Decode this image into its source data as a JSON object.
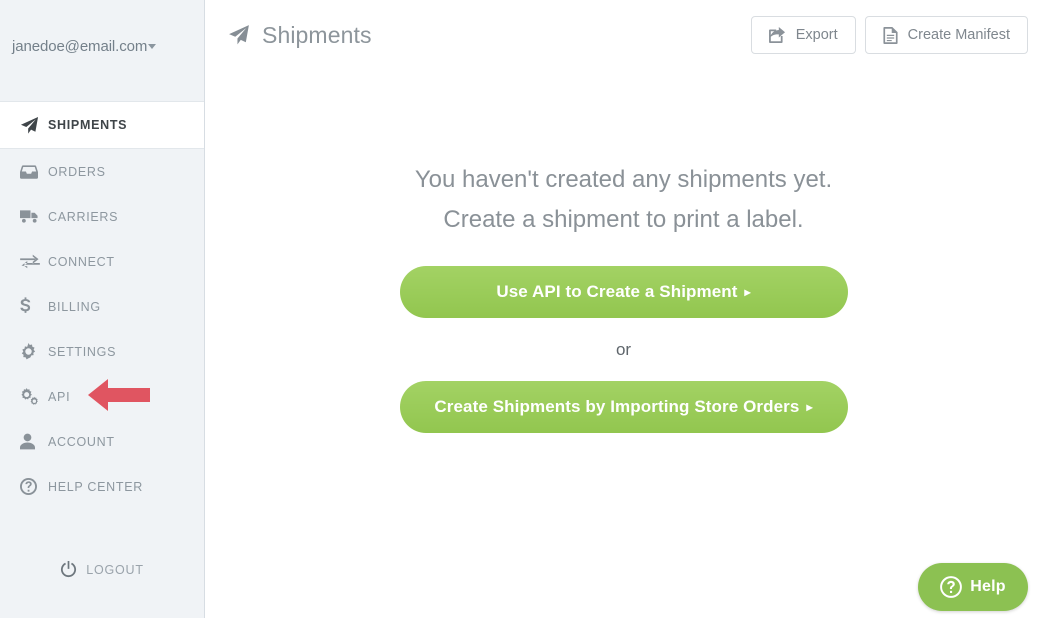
{
  "account": {
    "email": "janedoe@email.com",
    "caret_icon": "caret-down-icon"
  },
  "sidebar": {
    "items": [
      {
        "label": "SHIPMENTS",
        "icon": "paper-plane-icon",
        "active": true
      },
      {
        "label": "ORDERS",
        "icon": "inbox-icon",
        "active": false
      },
      {
        "label": "CARRIERS",
        "icon": "truck-icon",
        "active": false
      },
      {
        "label": "CONNECT",
        "icon": "exchange-icon",
        "active": false
      },
      {
        "label": "BILLING",
        "icon": "dollar-icon",
        "active": false
      },
      {
        "label": "SETTINGS",
        "icon": "gear-icon",
        "active": false
      },
      {
        "label": "API",
        "icon": "cogs-icon",
        "active": false
      },
      {
        "label": "ACCOUNT",
        "icon": "user-icon",
        "active": false
      },
      {
        "label": "HELP CENTER",
        "icon": "question-circle-icon",
        "active": false
      }
    ],
    "logout": {
      "label": "LOGOUT",
      "icon": "power-icon"
    },
    "background_color": "#f0f3f6",
    "active_background_color": "#ffffff"
  },
  "annotation": {
    "type": "arrow-left",
    "color": "#e05561",
    "points_to": "API"
  },
  "header": {
    "title": "Shipments",
    "title_icon": "paper-plane-icon",
    "buttons": [
      {
        "label": "Export",
        "icon": "share-export-icon"
      },
      {
        "label": "Create Manifest",
        "icon": "document-icon"
      }
    ]
  },
  "main": {
    "empty_state": {
      "line1": "You haven't created any shipments yet.",
      "line2": "Create a shipment to print a label."
    },
    "cta_primary": {
      "label": "Use API to Create a Shipment",
      "chevron": "▸"
    },
    "or_label": "or",
    "cta_secondary": {
      "label": "Create Shipments by Importing Store Orders",
      "chevron": "▸"
    },
    "green_color": "#9acd5a"
  },
  "help_widget": {
    "label": "Help",
    "icon": "question-circle-icon",
    "color": "#8cc152"
  }
}
